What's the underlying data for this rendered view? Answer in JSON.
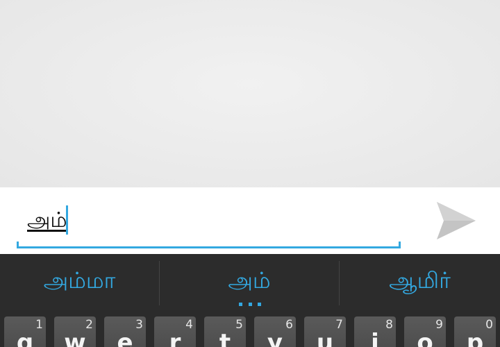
{
  "compose": {
    "input_value": "அம்",
    "send_icon": "send-icon"
  },
  "keyboard": {
    "suggestions": [
      "அம்மா",
      "அம்",
      "ஆமிர்"
    ],
    "keys": [
      {
        "hint": "1",
        "label": "q"
      },
      {
        "hint": "2",
        "label": "w"
      },
      {
        "hint": "3",
        "label": "e"
      },
      {
        "hint": "4",
        "label": "r"
      },
      {
        "hint": "5",
        "label": "t"
      },
      {
        "hint": "6",
        "label": "y"
      },
      {
        "hint": "7",
        "label": "u"
      },
      {
        "hint": "8",
        "label": "i"
      },
      {
        "hint": "9",
        "label": "o"
      },
      {
        "hint": "0",
        "label": "p"
      }
    ]
  },
  "colors": {
    "accent": "#33a8e0",
    "keyboard_bg": "#2b2b2b",
    "key_bg": "#535353"
  }
}
